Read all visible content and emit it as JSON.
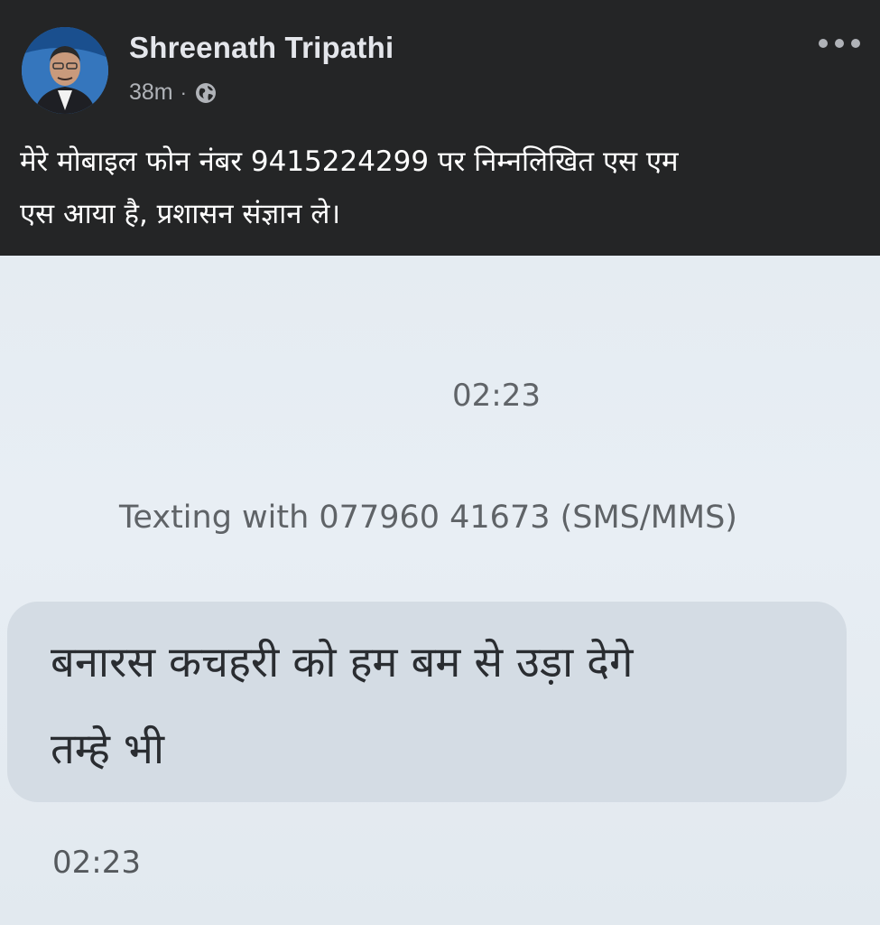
{
  "post": {
    "author": "Shreenath Tripathi",
    "time": "38m",
    "separator": "·",
    "privacy_icon": "globe-icon",
    "more_icon": "more-horizontal-icon",
    "text_line1": "मेरे मोबाइल फोन नंबर 9415224299 पर निम्नलिखित एस एम",
    "text_line2": "एस आया है, प्रशासन संज्ञान ले।"
  },
  "sms": {
    "time_top": "02:23",
    "texting_with": "Texting with 077960 41673 (SMS/MMS)",
    "message_line1": "बनारस कचहरी को हम बम से उड़ा देगे",
    "message_line2": "तम्हे भी",
    "time_bottom": "02:23"
  },
  "colors": {
    "post_background": "#242526",
    "author_text": "#e4e6eb",
    "meta_text": "#b0b3b8",
    "photo_background": "#e5ecf2",
    "bubble_background": "#d4dce4"
  }
}
